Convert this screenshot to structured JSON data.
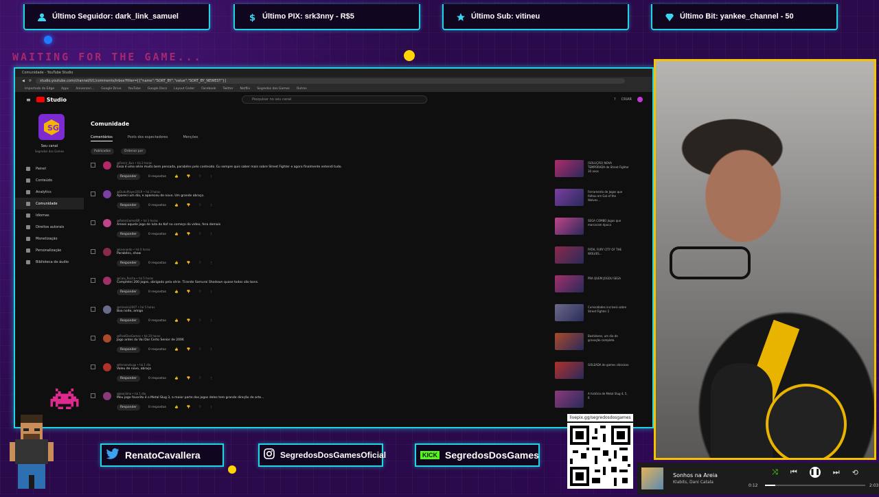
{
  "overlay": {
    "top_bars": [
      {
        "icon": "user-icon",
        "label": "Último Seguidor: dark_link_samuel"
      },
      {
        "icon": "dollar-icon",
        "label": "Último PIX: srk3nny - R$5"
      },
      {
        "icon": "star-icon",
        "label": "Último Sub: vitineu"
      },
      {
        "icon": "diamond-icon",
        "label": "Último Bit: yankee_channel - 50"
      }
    ],
    "waiting_text": "WAITING FOR THE GAME...",
    "socials": [
      {
        "icon": "twitter-icon",
        "name": "RenatoCavallera"
      },
      {
        "icon": "instagram-icon",
        "name": "SegredosDosGamesOficial"
      },
      {
        "icon": "kick-icon",
        "badge": "KICK",
        "name": "SegredosDosGames"
      }
    ],
    "qr_caption": "livepix.gg/segredosdosgames",
    "accent_color": "#22d4e6",
    "cam_border_color": "#f5c400"
  },
  "browser": {
    "tab_title": "Comunidade - YouTube Studio",
    "url": "studio.youtube.com/channel/UC/comments/inbox?filter=[{\"name\":\"SORT_BY\",\"value\":\"SORT_BY_NEWEST\"}]",
    "bookmarks": [
      "Importado do Edge",
      "Apps",
      "Aniversari...",
      "Google Drive",
      "YouTube",
      "Google Docs",
      "Layout Ceder",
      "Facebook",
      "Twitter",
      "Netflix",
      "Segredos dos Games",
      "Outros"
    ]
  },
  "studio": {
    "logo": "Studio",
    "search_placeholder": "Pesquisar no seu canal",
    "create_label": "CRIAR",
    "channel_label": "Seu canal",
    "channel_name": "Segredos dos Games",
    "nav": [
      "Painel",
      "Conteúdo",
      "Analytics",
      "Comunidade",
      "Idiomas",
      "Direitos autorais",
      "Monetização",
      "Personalização",
      "Biblioteca de áudio"
    ],
    "page_title": "Comunidade",
    "subtabs": [
      "Comentários",
      "Posts dos espectadores",
      "Menções"
    ],
    "filter_label": "Publicados",
    "sort_label": "Ordenar por",
    "reply_label": "Responder",
    "replies_label": "0 respostas",
    "comments": [
      {
        "author": "@Fenrir_Kun",
        "time": "há 2 horas",
        "text": "Essa é uma série muito bem pensada, parabéns pelo conteúdo. Eu sempre quis saber mais sobre Street Fighter e agora finalmente entendi tudo.",
        "video": "[SOLUÇÃO] NOVA TEMPORADA de Street Fighter 30 anos"
      },
      {
        "author": "@DuduPlayer2019",
        "time": "há 3 horas",
        "text": "Apareci um dia, e apareceu de novo. Um grande abraço.",
        "video": "Ferramenta de Jogos que falhou em Gal of the Wolves..."
      },
      {
        "author": "@RetroGamerBR",
        "time": "há 3 horas",
        "text": "Ameei aquele jogo de luta do Kof no começo do vídeo, fera demais",
        "video": "SEGA COMBO Jogos que marcaram época"
      },
      {
        "author": "@Leonardo",
        "time": "há 4 horas",
        "text": "Parabéns, show",
        "video": "FATAL FURY CITY OF THE WOLVES..."
      },
      {
        "author": "@Caio_Rocha",
        "time": "há 5 horas",
        "text": "Completei 200 jogos, obrigado pela série. Tirando Samurai Shodown quase todos são bons.",
        "video": "PRA QUEM JOGOU SEGA"
      },
      {
        "author": "@mineiro2007",
        "time": "há 5 horas",
        "text": "Boa noite, amigo",
        "video": "Curiosidades incríveis sobre Street Fighter 2"
      },
      {
        "author": "@PixelDosGames",
        "time": "há 20 horas",
        "text": "Jogo antes do Vai Dar Certo Senior de 2006",
        "video": "Bastidores, um dia de gravação completa"
      },
      {
        "author": "@fernando.gp",
        "time": "há 1 dia",
        "text": "Valeu de novo, abraço",
        "video": "GOLEADA de games clássicos"
      },
      {
        "author": "@Jeanlima",
        "time": "há 1 dia",
        "text": "Meu jogo favorito é o Metal Slug 3, a maior parte dos jogos deles tem grande direção de arte...",
        "video": "A história de Metal Slug 4, 5, 6"
      }
    ]
  },
  "player": {
    "song": "Sonhos na Areia",
    "artist": "Klabits, Dani Catala",
    "elapsed": "0:12",
    "duration": "2:03",
    "progress": 0.1
  }
}
